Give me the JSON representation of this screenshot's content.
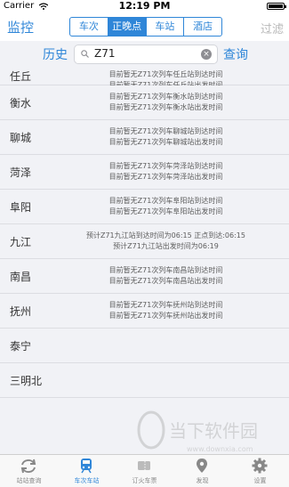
{
  "status_bar": {
    "carrier": "Carrier",
    "time": "12:19 PM"
  },
  "nav": {
    "monitor": "监控",
    "segments": [
      "车次",
      "正晚点",
      "车站",
      "酒店"
    ],
    "active_segment": "正晚点",
    "filter": "过滤"
  },
  "search": {
    "history": "历史",
    "query_value": "Z71",
    "query_button": "查询"
  },
  "rows": [
    {
      "station": "任丘",
      "lines": [
        "目前暂无Z71次列车任丘站到达时间",
        "目前暂无Z71次列车任丘站出发时间"
      ]
    },
    {
      "station": "衡水",
      "lines": [
        "目前暂无Z71次列车衡水站到达时间",
        "目前暂无Z71次列车衡水站出发时间"
      ]
    },
    {
      "station": "聊城",
      "lines": [
        "目前暂无Z71次列车聊城站到达时间",
        "目前暂无Z71次列车聊城站出发时间"
      ]
    },
    {
      "station": "菏泽",
      "lines": [
        "目前暂无Z71次列车菏泽站到达时间",
        "目前暂无Z71次列车菏泽站出发时间"
      ]
    },
    {
      "station": "阜阳",
      "lines": [
        "目前暂无Z71次列车阜阳站到达时间",
        "目前暂无Z71次列车阜阳站出发时间"
      ]
    },
    {
      "station": "九江",
      "lines": [
        "预计Z71九江站到达时间为06:15 正点到达:06:15",
        "预计Z71九江站出发时间为06:19"
      ]
    },
    {
      "station": "南昌",
      "lines": [
        "目前暂无Z71次列车南昌站到达时间",
        "目前暂无Z71次列车南昌站出发时间"
      ]
    },
    {
      "station": "抚州",
      "lines": [
        "目前暂无Z71次列车抚州站到达时间",
        "目前暂无Z71次列车抚州站出发时间"
      ]
    },
    {
      "station": "泰宁",
      "lines": []
    },
    {
      "station": "三明北",
      "lines": []
    }
  ],
  "tabbar": {
    "items": [
      {
        "label": "站站查询",
        "icon": "refresh-arrows-icon"
      },
      {
        "label": "车次车站",
        "icon": "train-icon"
      },
      {
        "label": "订火车票",
        "icon": "ticket-icon"
      },
      {
        "label": "发现",
        "icon": "location-pin-icon"
      },
      {
        "label": "设置",
        "icon": "gear-icon"
      }
    ],
    "active": "车次车站"
  },
  "colors": {
    "accent": "#2f86d8",
    "background": "#f1f2f6"
  },
  "watermark": {
    "text": "当下软件园",
    "url_text": "www.downxia.com"
  }
}
